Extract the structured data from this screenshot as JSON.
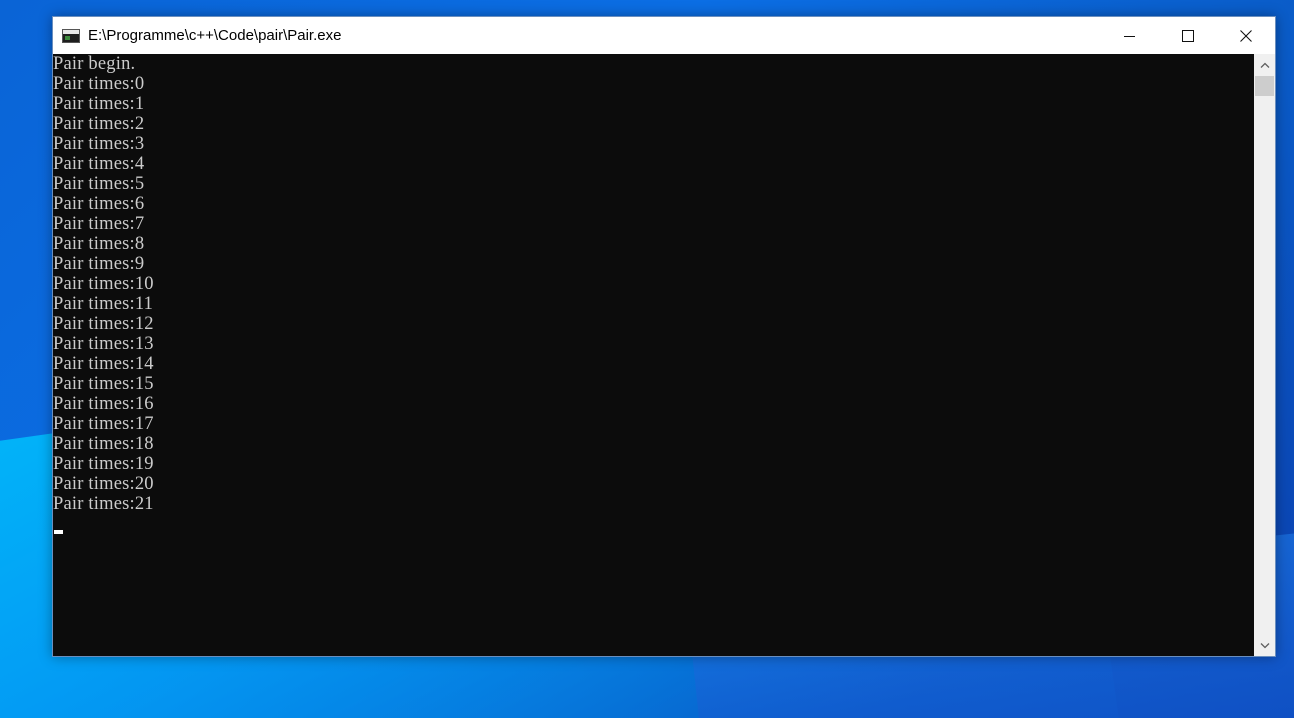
{
  "window": {
    "title": "E:\\Programme\\c++\\Code\\pair\\Pair.exe",
    "minimize_icon": "minimize-icon",
    "maximize_icon": "maximize-icon",
    "close_icon": "close-icon"
  },
  "console": {
    "lines": [
      "Pair begin.",
      "Pair times:0",
      "Pair times:1",
      "Pair times:2",
      "Pair times:3",
      "Pair times:4",
      "Pair times:5",
      "Pair times:6",
      "Pair times:7",
      "Pair times:8",
      "Pair times:9",
      "Pair times:10",
      "Pair times:11",
      "Pair times:12",
      "Pair times:13",
      "Pair times:14",
      "Pair times:15",
      "Pair times:16",
      "Pair times:17",
      "Pair times:18",
      "Pair times:19",
      "Pair times:20",
      "Pair times:21"
    ],
    "text_color": "#cccccc",
    "background_color": "#0c0c0c"
  }
}
